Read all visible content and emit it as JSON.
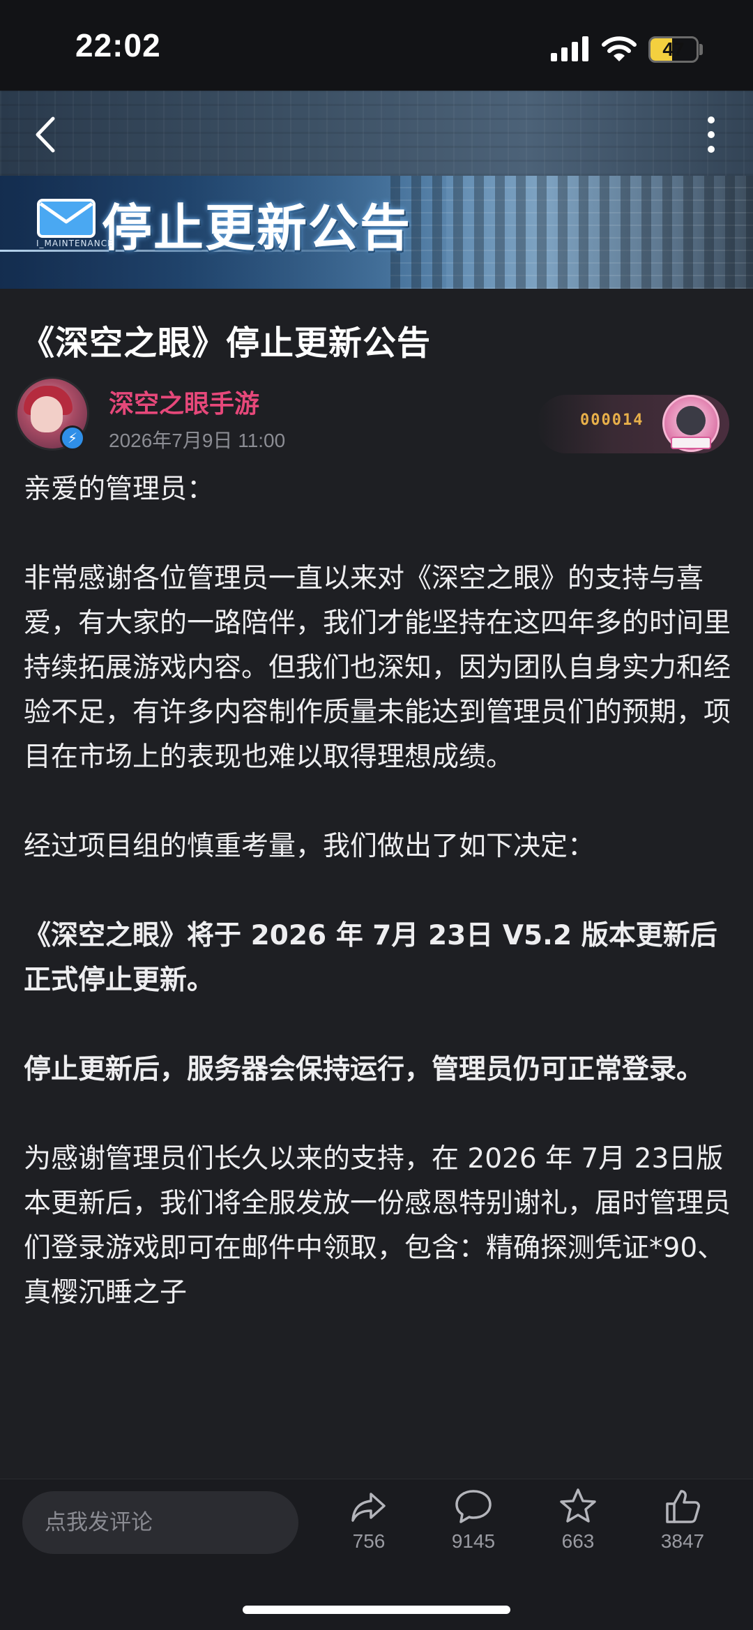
{
  "status_bar": {
    "time": "22:02",
    "battery_level": "47",
    "battery_fraction": 0.47
  },
  "nav": {
    "back_icon": "chevron-left-icon",
    "more_icon": "more-vertical-icon"
  },
  "banner": {
    "title": "停止更新公告",
    "subtitle": "I_MAINTENANCE",
    "icon": "mail-icon"
  },
  "article": {
    "title": "《深空之眼》停止更新公告",
    "author": "深空之眼手游",
    "time": "2026年7月9日 11:00",
    "badge_number": "000014",
    "paragraphs": [
      {
        "text": "亲爱的管理员：",
        "bold": false
      },
      {
        "text": "非常感谢各位管理员一直以来对《深空之眼》的支持与喜爱，有大家的一路陪伴，我们才能坚持在这四年多的时间里持续拓展游戏内容。但我们也深知，因为团队自身实力和经验不足，有许多内容制作质量未能达到管理员们的预期，项目在市场上的表现也难以取得理想成绩。",
        "bold": false
      },
      {
        "text": "经过项目组的慎重考量，我们做出了如下决定：",
        "bold": false
      },
      {
        "text": "《深空之眼》将于 2026 年 7月 23日 V5.2 版本更新后正式停止更新。",
        "bold": true
      },
      {
        "text": "停止更新后，服务器会保持运行，管理员仍可正常登录。",
        "bold": true
      },
      {
        "text": "为感谢管理员们长久以来的支持，在 2026 年 7月 23日版本更新后，我们将全服发放一份感恩特别谢礼，届时管理员们登录游戏即可在邮件中领取，包含：精确探测凭证*90、真樱沉睡之子",
        "bold": false
      }
    ]
  },
  "bottom_bar": {
    "comment_placeholder": "点我发评论",
    "actions": [
      {
        "name": "share",
        "icon": "share-icon",
        "count": "756"
      },
      {
        "name": "comment",
        "icon": "comment-icon",
        "count": "9145"
      },
      {
        "name": "favorite",
        "icon": "star-icon",
        "count": "663"
      },
      {
        "name": "like",
        "icon": "thumbs-up-icon",
        "count": "3847"
      }
    ]
  }
}
